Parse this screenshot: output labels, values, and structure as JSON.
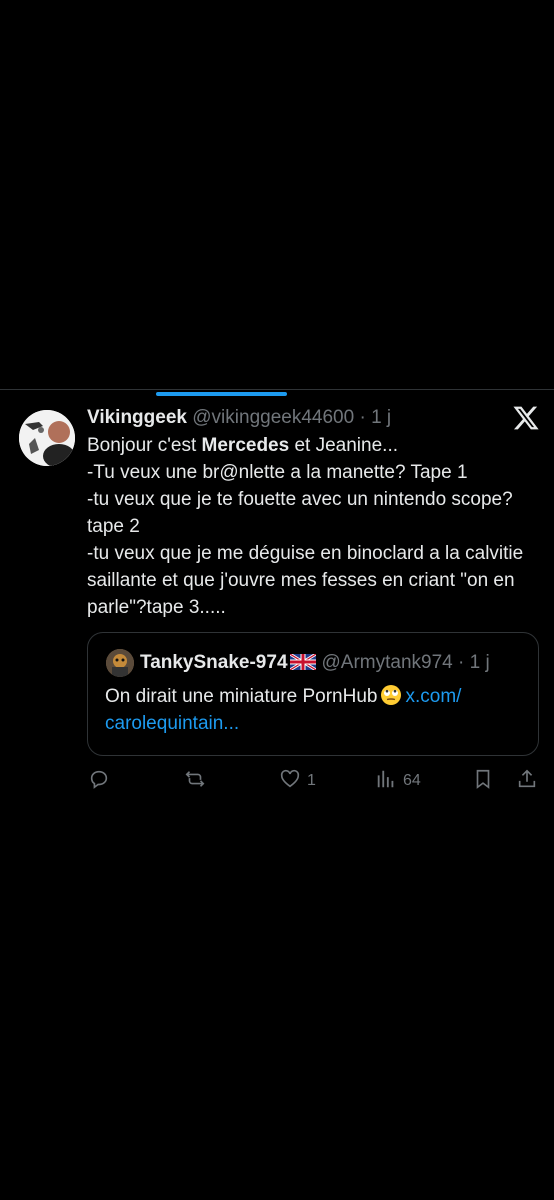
{
  "tweet": {
    "display_name": "Vikinggeek",
    "handle": "@vikinggeek44600",
    "separator": "·",
    "time": "1 j",
    "text_intro": "Bonjour c'est ",
    "text_bold": "Mercedes",
    "text_rest": " et Jeanine...\n-Tu veux une br@nlette a la manette? Tape 1\n-tu veux que je te fouette avec un nintendo scope?tape 2\n-tu veux que je me déguise en binoclard a la calvitie saillante et que j'ouvre mes fesses en criant \"on en parle\"?tape 3....."
  },
  "quote": {
    "display_name": "TankySnake-974",
    "flag_icon": "uk-flag-icon",
    "handle": "@Armytank974",
    "separator": "·",
    "time": "1 j",
    "text": "On dirait une miniature PornHub",
    "emoji_icon": "eye-roll-emoji-icon",
    "link_text": "x.com/\ncarolequintain..."
  },
  "actions": {
    "reply_icon": "reply-icon",
    "retweet_icon": "retweet-icon",
    "like_icon": "heart-icon",
    "like_count": "1",
    "views_icon": "views-icon",
    "views_count": "64",
    "bookmark_icon": "bookmark-icon",
    "share_icon": "share-icon"
  },
  "colors": {
    "background": "#000000",
    "text": "#e7e9ea",
    "muted": "#71767b",
    "accent": "#1d9bf0",
    "border": "#2f3336"
  }
}
